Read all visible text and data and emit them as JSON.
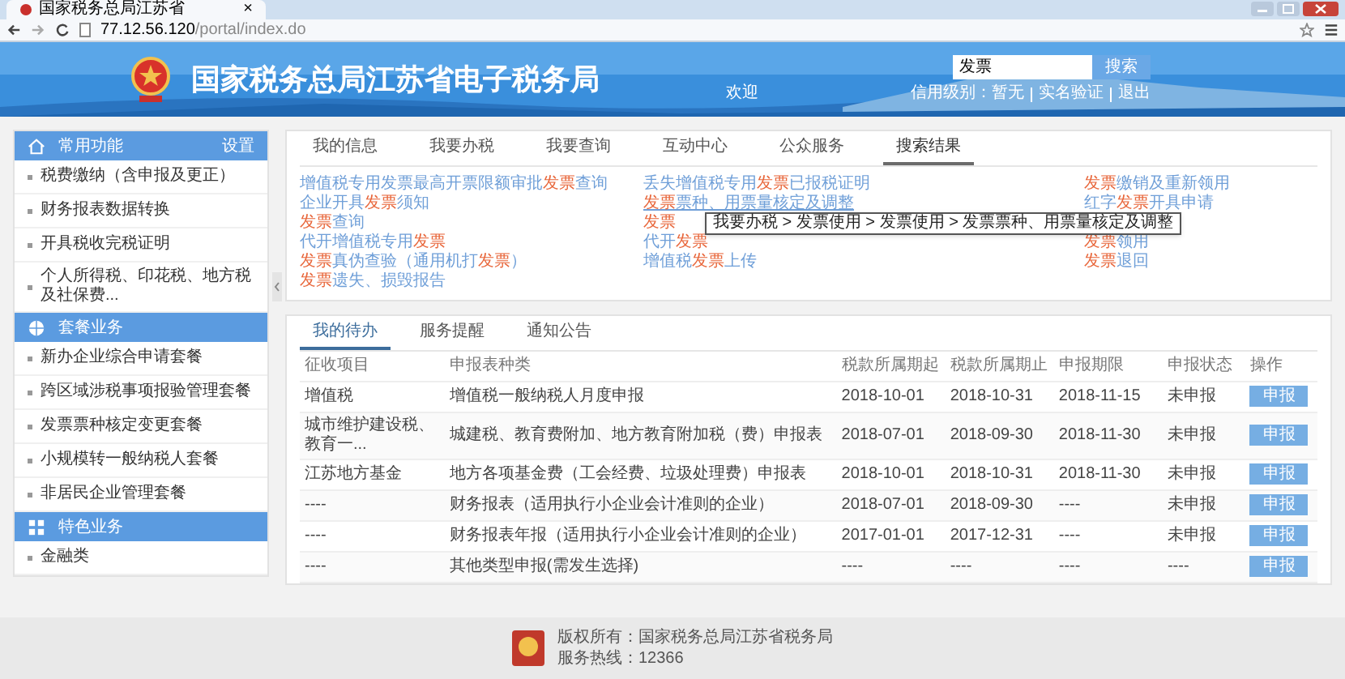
{
  "browser": {
    "tab_title": "国家税务总局江苏省",
    "tab_close": "×",
    "url_host": "77.12.56.120",
    "url_path": "/portal/index.do"
  },
  "header": {
    "title": "国家税务总局江苏省电子税务局",
    "search": {
      "value": "发票"
    },
    "search_button": "搜索",
    "welcome": "欢迎",
    "links": [
      "信用级别：暂无",
      "实名验证",
      "退出"
    ]
  },
  "sidebar": [
    {
      "title": "常用功能",
      "kind": "home",
      "action": "设置",
      "items": [
        "税费缴纳（含申报及更正）",
        "财务报表数据转换",
        "开具税收完税证明",
        "个人所得税、印花税、地方税及社保费..."
      ]
    },
    {
      "title": "套餐业务",
      "kind": "globe",
      "items": [
        "新办企业综合申请套餐",
        "跨区域涉税事项报验管理套餐",
        "发票票种核定变更套餐",
        "小规模转一般纳税人套餐",
        "非居民企业管理套餐"
      ]
    },
    {
      "title": "特色业务",
      "kind": "grid",
      "items": [
        "金融类"
      ]
    }
  ],
  "tabs": [
    {
      "label": "我的信息",
      "selected": false
    },
    {
      "label": "我要办税",
      "selected": false
    },
    {
      "label": "我要查询",
      "selected": false
    },
    {
      "label": "互动中心",
      "selected": false
    },
    {
      "label": "公众服务",
      "selected": false
    },
    {
      "label": "搜索结果",
      "selected": true
    }
  ],
  "results": [
    [
      [
        {
          "text": "增值税专用发票最高开票限额审批",
          "hit": false
        },
        {
          "text": "发票",
          "hit": true
        },
        {
          "text": "查询",
          "hit": false
        }
      ],
      [
        {
          "text": "企业开具",
          "hit": false
        },
        {
          "text": "发票",
          "hit": true
        },
        {
          "text": "须知",
          "hit": false
        }
      ],
      [
        {
          "text": "发票",
          "hit": true
        },
        {
          "text": "查询",
          "hit": false
        }
      ],
      [
        {
          "text": "代开增值税专用",
          "hit": false
        },
        {
          "text": "发票",
          "hit": true
        }
      ],
      [
        {
          "text": "发票",
          "hit": true
        },
        {
          "text": "真伪查验（通用机打",
          "hit": false
        },
        {
          "text": "发票",
          "hit": true
        },
        {
          "text": "）",
          "hit": false
        }
      ],
      [
        {
          "text": "发票",
          "hit": true
        },
        {
          "text": "遗失、损毁报告",
          "hit": false
        }
      ]
    ],
    [
      [
        {
          "text": "丢失增值税专用",
          "hit": false
        },
        {
          "text": "发票",
          "hit": true
        },
        {
          "text": "已报税证明",
          "hit": false
        }
      ],
      [
        {
          "text": "发票",
          "hit": true
        },
        {
          "text": "票种、用票量核定及调整",
          "hit": false
        }
      ],
      [
        {
          "text": "发票",
          "hit": true
        }
      ],
      [
        {
          "text": "代开",
          "hit": false
        },
        {
          "text": "发票",
          "hit": true
        }
      ],
      [
        {
          "text": "增值税",
          "hit": false
        },
        {
          "text": "发票",
          "hit": true
        },
        {
          "text": "上传",
          "hit": false
        }
      ]
    ],
    [
      [
        {
          "text": "发票",
          "hit": true
        },
        {
          "text": "缴销及重新领用",
          "hit": false
        }
      ],
      [
        {
          "text": "红字",
          "hit": false
        },
        {
          "text": "发票",
          "hit": true
        },
        {
          "text": "开具申请",
          "hit": false
        }
      ],
      [
        {
          "text": "发票",
          "hit": true
        },
        {
          "text": "领用",
          "hit": false
        }
      ],
      [
        {
          "text": "发票",
          "hit": true
        },
        {
          "text": "退回",
          "hit": false
        }
      ]
    ]
  ],
  "hovered_link": {
    "hovered": true
  },
  "tooltip": "我要办税 > 发票使用 > 发票使用 > 发票票种、用票量核定及调整",
  "lower_tabs": [
    {
      "label": "我的待办",
      "selected": true
    },
    {
      "label": "服务提醒",
      "selected": false
    },
    {
      "label": "通知公告",
      "selected": false
    }
  ],
  "table": {
    "columns": [
      "征收项目",
      "申报表种类",
      "税款所属期起",
      "税款所属期止",
      "申报期限",
      "申报状态",
      "操作"
    ],
    "rows": [
      [
        "增值税",
        "增值税一般纳税人月度申报",
        "2018-10-01",
        "2018-10-31",
        "2018-11-15",
        "未申报",
        "申报"
      ],
      [
        "城市维护建设税、教育一...",
        "城建税、教育费附加、地方教育附加税（费）申报表",
        "2018-07-01",
        "2018-09-30",
        "2018-11-30",
        "未申报",
        "申报"
      ],
      [
        "江苏地方基金",
        "地方各项基金费（工会经费、垃圾处理费）申报表",
        "2018-10-01",
        "2018-10-31",
        "2018-11-30",
        "未申报",
        "申报"
      ],
      [
        "----",
        "财务报表（适用执行小企业会计准则的企业）",
        "2018-07-01",
        "2018-09-30",
        "----",
        "未申报",
        "申报"
      ],
      [
        "----",
        "财务报表年报（适用执行小企业会计准则的企业）",
        "2017-01-01",
        "2017-12-31",
        "----",
        "未申报",
        "申报"
      ],
      [
        "----",
        "其他类型申报(需发生选择)",
        "----",
        "----",
        "----",
        "----",
        "申报"
      ]
    ]
  },
  "footer": {
    "copyright": "版权所有：国家税务总局江苏省税务局",
    "hotline": "服务热线：12366"
  }
}
